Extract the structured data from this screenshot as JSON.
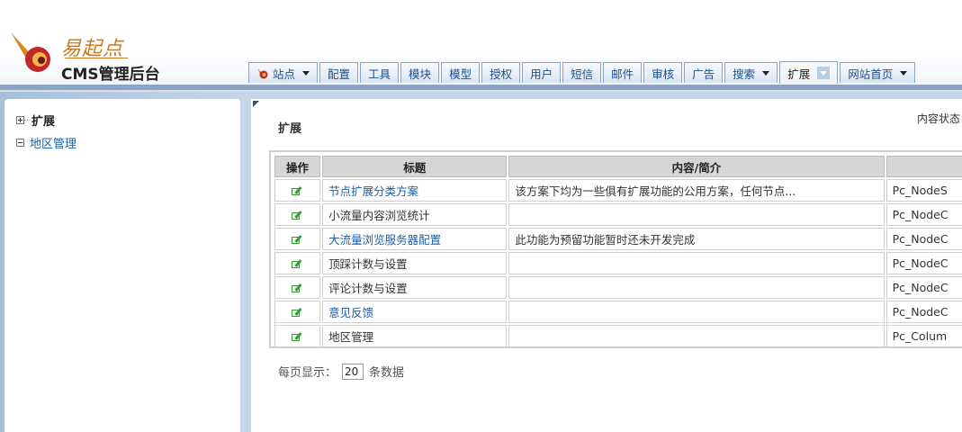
{
  "brand": {
    "script_text": "易起点",
    "subtitle": "CMS管理后台"
  },
  "nav": {
    "tabs": [
      {
        "label": "站点",
        "dropdown": true,
        "icon": "site-icon"
      },
      {
        "label": "配置"
      },
      {
        "label": "工具"
      },
      {
        "label": "模块"
      },
      {
        "label": "模型"
      },
      {
        "label": "授权"
      },
      {
        "label": "用户"
      },
      {
        "label": "短信"
      },
      {
        "label": "邮件"
      },
      {
        "label": "审核"
      },
      {
        "label": "广告"
      },
      {
        "label": "搜索",
        "dropdown": true
      },
      {
        "label": "扩展",
        "dropdown": true,
        "active": true
      },
      {
        "label": "网站首页",
        "dropdown": true
      }
    ]
  },
  "sidebar": {
    "items": [
      {
        "label": "扩展",
        "expander": "plus",
        "style": "bold"
      },
      {
        "label": "地区管理",
        "expander": "minus",
        "style": "link"
      }
    ]
  },
  "main": {
    "title": "扩展",
    "status_text": "内容状态",
    "table": {
      "headers": [
        "操作",
        "标题",
        "内容/简介",
        ""
      ],
      "rows": [
        {
          "title": "节点扩展分类方案",
          "link": true,
          "content": "该方案下均为一些俱有扩展功能的公用方案，任何节点...",
          "extra": "Pc_NodeS"
        },
        {
          "title": "小流量内容浏览统计",
          "link": false,
          "content": "",
          "extra": "Pc_NodeC"
        },
        {
          "title": "大流量浏览服务器配置",
          "link": true,
          "content": "此功能为预留功能暂时还未开发完成",
          "extra": "Pc_NodeC"
        },
        {
          "title": "顶踩计数与设置",
          "link": false,
          "content": "",
          "extra": "Pc_NodeC"
        },
        {
          "title": "评论计数与设置",
          "link": false,
          "content": "",
          "extra": "Pc_NodeC"
        },
        {
          "title": "意见反馈",
          "link": true,
          "content": "",
          "extra": "Pc_NodeC"
        },
        {
          "title": "地区管理",
          "link": false,
          "content": "",
          "extra": "Pc_Colum"
        }
      ]
    },
    "per_page": {
      "prefix": "每页显示：",
      "value": "20",
      "suffix": "条数据"
    }
  },
  "colors": {
    "accent_blue": "#1a5fa8",
    "band": "#8aa4c2",
    "logo_orange": "#c9781d",
    "logo_red": "#c0282d"
  }
}
